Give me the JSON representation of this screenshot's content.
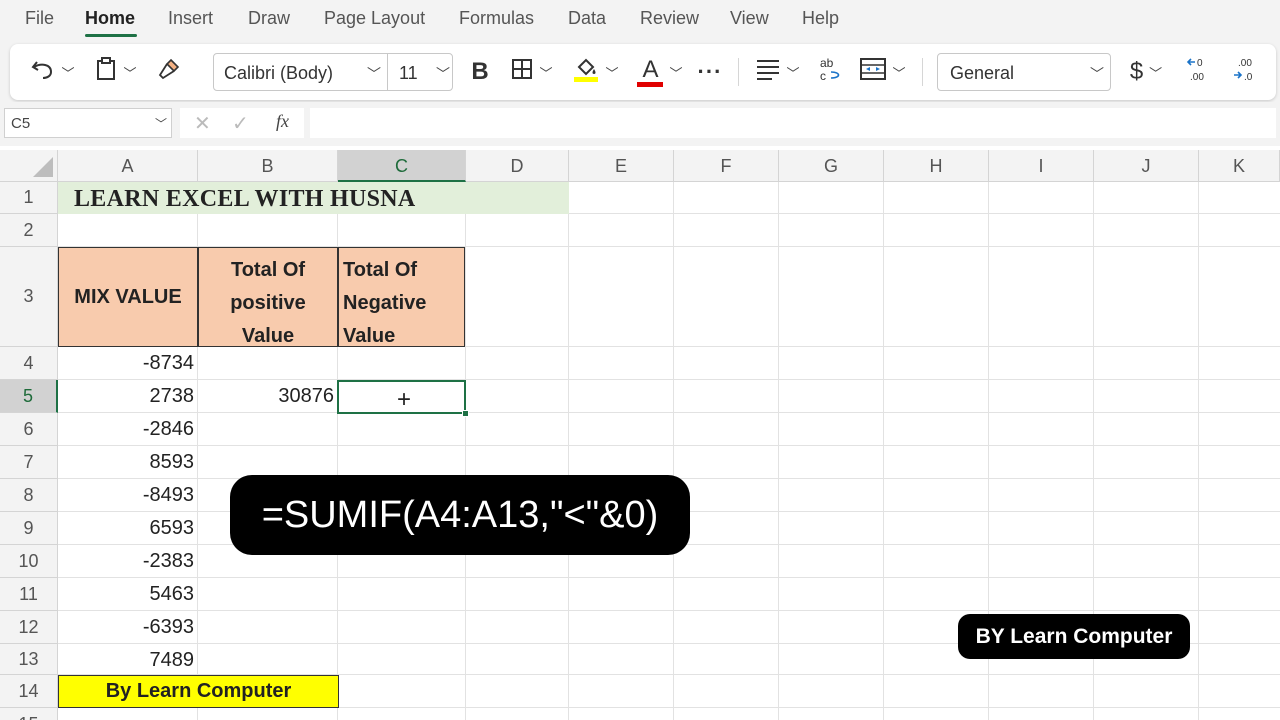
{
  "menu": {
    "tabs": [
      "File",
      "Home",
      "Insert",
      "Draw",
      "Page Layout",
      "Formulas",
      "Data",
      "Review",
      "View",
      "Help"
    ],
    "active": "Home"
  },
  "ribbon": {
    "font_name": "Calibri (Body)",
    "font_size": "11",
    "bold_label": "B",
    "font_color_label": "A",
    "more_label": "···",
    "number_format": "General",
    "currency_symbol": "$",
    "fill_color": "#ffff00",
    "font_color": "#e00000",
    "icons": [
      "undo-icon",
      "paste-icon",
      "format-painter-icon",
      "borders-icon",
      "fill-color-icon",
      "font-color-icon",
      "more-icon",
      "align-icon",
      "wrap-text-icon",
      "merge-icon",
      "currency-icon",
      "increase-decimal-icon",
      "decrease-decimal-icon"
    ]
  },
  "formula_bar": {
    "name_box": "C5",
    "fx_label": "fx",
    "formula": ""
  },
  "columns": [
    "A",
    "B",
    "C",
    "D",
    "E",
    "F",
    "G",
    "H",
    "I",
    "J",
    "K"
  ],
  "rows": [
    "1",
    "2",
    "3",
    "4",
    "5",
    "6",
    "7",
    "8",
    "9",
    "10",
    "11",
    "12",
    "13",
    "14",
    "15"
  ],
  "selected_cell": "C5",
  "sheet": {
    "title": "LEARN EXCEL WITH HUSNA",
    "title_bg": "#e2efda",
    "headers": {
      "a": "MIX VALUE",
      "b_lines": [
        "Total Of",
        "positive",
        "Value"
      ],
      "c_lines": [
        "Total Of",
        "Negative",
        "Value"
      ]
    },
    "header_bg": "#f8cbad",
    "values": [
      "-8734",
      "2738",
      "-2846",
      "8593",
      "-8493",
      "6593",
      "-2383",
      "5463",
      "-6393",
      "7489"
    ],
    "positive_total": "30876",
    "footer": "By Learn Computer",
    "footer_bg": "#ffff00"
  },
  "overlay": {
    "formula_text": "=SUMIF(A4:A13,\"<\"&0)",
    "credit_text": "BY Learn Computer"
  }
}
